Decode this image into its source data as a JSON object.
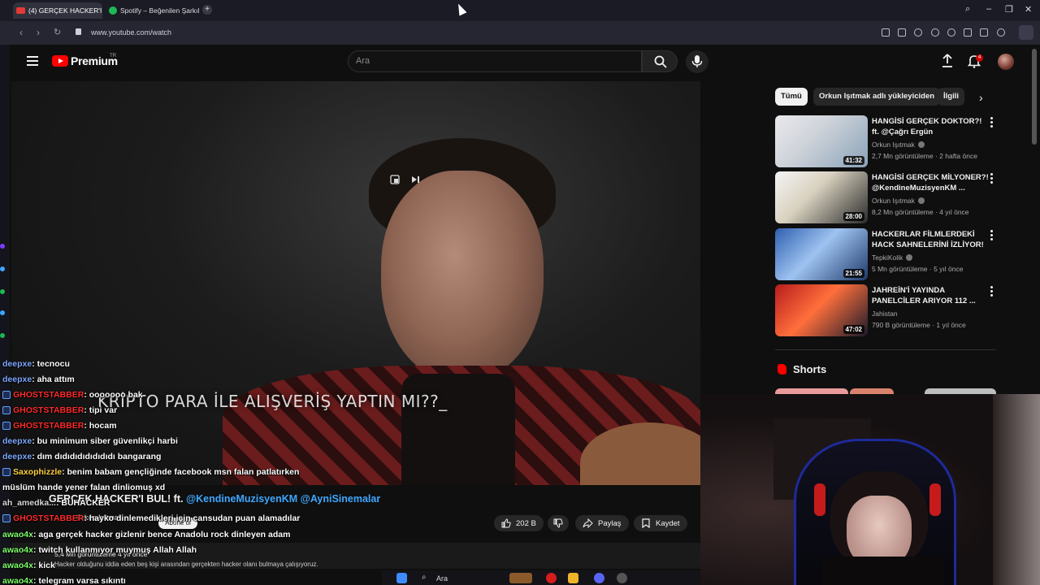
{
  "browser": {
    "tabs": [
      {
        "label": "(4) GERÇEK HACKER'I",
        "active": true
      },
      {
        "label": "Spotify – Beğenilen Şarkıl",
        "active": false
      }
    ],
    "url": "www.youtube.com/watch"
  },
  "header": {
    "logo": "Premium",
    "region": "TR",
    "search_placeholder": "Ara",
    "notification_count": "4"
  },
  "video": {
    "caption": "KRİPTO PARA İLE ALIŞVERİŞ YAPTIN MI??_",
    "title_prefix": "GERÇEK HACKER'I BUL! ft.",
    "title_mentions": "@KendineMuzisyenKM @AyniSinemalar",
    "channel": "Orkun Işıtmak",
    "subscribe_label": "Abone ol",
    "likes": "202 B",
    "share_label": "Paylaş",
    "save_label": "Kaydet",
    "meta": "5,4 Mn görüntüleme  4 yıl önce",
    "description": "Hacker olduğunu iddia eden beş kişi arasından gerçekten hacker olanı bulmaya çalışıyoruz."
  },
  "chat": [
    {
      "user": "deepxe",
      "text": " : tecnocu",
      "color": "#7ea8ff",
      "badge": false
    },
    {
      "user": "deepxe",
      "text": " : aha attım",
      "color": "#7ea8ff",
      "badge": false
    },
    {
      "user": "GHOSTSTABBER",
      "text": " : ooooooo bak",
      "color": "#ff2b2b",
      "badge": true
    },
    {
      "user": "GHOSTSTABBER",
      "text": " : tipi var",
      "color": "#ff2b2b",
      "badge": true
    },
    {
      "user": "GHOSTSTABBER",
      "text": " : hocam",
      "color": "#ff2b2b",
      "badge": true
    },
    {
      "user": "deepxe",
      "text": " : bu minimum siber güvenlikçi harbi",
      "color": "#7ea8ff",
      "badge": false
    },
    {
      "user": "deepxe",
      "text": " : dım dıdıdıdıdıdıdıdı bangarang",
      "color": "#7ea8ff",
      "badge": false
    },
    {
      "user": "Saxophizzle",
      "text": " : benim babam gençliğinde facebook msn falan patlatırken",
      "color": "#ffd23f",
      "badge": true
    },
    {
      "user": "",
      "text": "müslüm hande yener falan dinliomuş xd",
      "color": "#ffffff",
      "badge": false
    },
    {
      "user": "ah_amedka...",
      "text": " : BUHACKER",
      "color": "#d7d7d7",
      "badge": false
    },
    {
      "user": "GHOSTSTABBER",
      "text": " : hayko dinlemedikleri için cansudan puan alamadılar",
      "color": "#ff2b2b",
      "badge": true
    },
    {
      "user": "awao4x",
      "text": " : aga gerçek hacker gizlenir bence Anadolu rock dinleyen adam",
      "color": "#7dff6a",
      "badge": false
    },
    {
      "user": "awao4x",
      "text": " : twitch kullanmıyor muymuş Allah Allah",
      "color": "#7dff6a",
      "badge": false
    },
    {
      "user": "awao4x",
      "text": " : kick",
      "color": "#7dff6a",
      "badge": false
    },
    {
      "user": "awao4x",
      "text": " : telegram varsa sıkıntı",
      "color": "#7dff6a",
      "badge": false
    }
  ],
  "sidebar": {
    "chips": [
      "Tümü",
      "Orkun Işıtmak adlı yükleyiciden",
      "İlgili"
    ],
    "recommendations": [
      {
        "title": "HANGİSİ GERÇEK DOKTOR?! ft. @Çağrı Ergün",
        "channel": "Orkun Işıtmak",
        "meta": "2,7 Mn görüntüleme · 2 hafta önce",
        "duration": "41:32",
        "verified": true
      },
      {
        "title": "HANGİSİ GERÇEK MİLYONER?! @KendineMuzisyenKM ...",
        "channel": "Orkun Işıtmak",
        "meta": "8,2 Mn görüntüleme · 4 yıl önce",
        "duration": "28:00",
        "verified": true
      },
      {
        "title": "HACKERLAR FİLMLERDEKİ HACK SAHNELERİNİ İZLİYOR!",
        "channel": "TepkiKolik",
        "meta": "5 Mn görüntüleme · 5 yıl önce",
        "duration": "21:55",
        "verified": true
      },
      {
        "title": "JAHREİN'İ YAYINDA PANELCİLER ARIYOR 112 ...",
        "channel": "Jahistan",
        "meta": "790 B görüntüleme · 1 yıl önce",
        "duration": "47:02",
        "verified": false
      }
    ],
    "shorts_label": "Shorts"
  },
  "taskbar": {
    "search_label": "Ara"
  },
  "colors": {
    "accent": "#ff0000",
    "link": "#3ea6ff",
    "background": "#0f0f0f"
  }
}
